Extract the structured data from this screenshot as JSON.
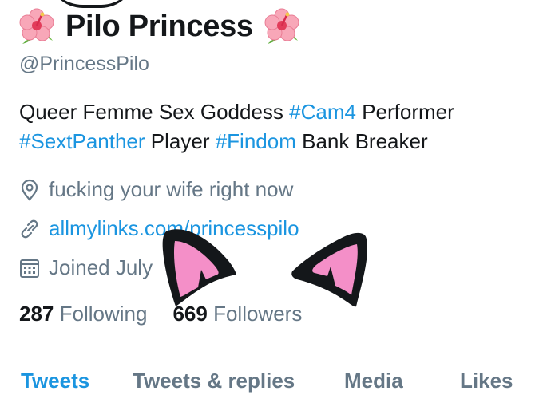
{
  "profile": {
    "display_name": "Pilo Princess",
    "handle": "@PrincessPilo",
    "name_emoji_icon": "hibiscus-icon"
  },
  "bio": {
    "part1": "Queer Femme Sex Goddess ",
    "tag1": "#Cam4",
    "part2": " Performer",
    "tag2": "#SextPanther",
    "part3": " Player ",
    "tag3": "#Findom",
    "part4": " Bank Breaker"
  },
  "meta": {
    "location": "fucking your wife right now",
    "location_icon": "location-pin-icon",
    "website": "allmylinks.com/princesspilo",
    "website_icon": "link-icon",
    "joined": "Joined July",
    "joined_icon": "calendar-icon"
  },
  "stats": {
    "following_count": "287",
    "following_label": "Following",
    "followers_count": "669",
    "followers_label": "Followers"
  },
  "tabs": [
    {
      "label": "Tweets",
      "active": true
    },
    {
      "label": "Tweets & replies",
      "active": false
    },
    {
      "label": "Media",
      "active": false
    },
    {
      "label": "Likes",
      "active": false
    }
  ],
  "colors": {
    "accent": "#1b95e0",
    "secondary_text": "#657786",
    "primary_text": "#14171a",
    "ear_pink": "#f48fc8"
  },
  "overlay": {
    "sticker_icon": "cat-ears-icon"
  }
}
